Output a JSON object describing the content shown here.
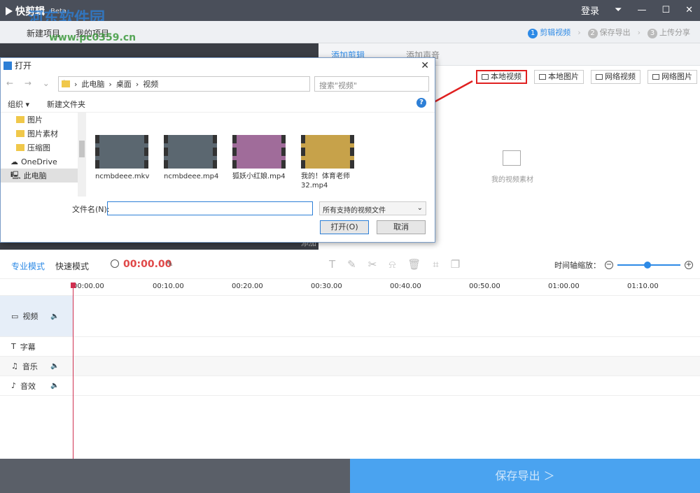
{
  "app": {
    "title": "快剪辑",
    "beta": "Beta",
    "login": "登录",
    "watermark": "河东软件园",
    "watermark_url": "www.pc0359.cn"
  },
  "toolbar2": {
    "new_project": "新建项目",
    "my_projects": "我的项目",
    "steps": [
      {
        "num": "1",
        "label": "剪辑视频"
      },
      {
        "num": "2",
        "label": "保存导出"
      },
      {
        "num": "3",
        "label": "上传分享"
      }
    ]
  },
  "material": {
    "tabs": [
      "添加剪辑",
      "添加声音"
    ],
    "buttons": [
      "本地视频",
      "本地图片",
      "网络视频",
      "网络图片"
    ],
    "empty_text": "我的视频素材",
    "preview_label": "添加剪辑素材"
  },
  "dialog": {
    "title": "打开",
    "path": [
      "此电脑",
      "桌面",
      "视频"
    ],
    "search_placeholder": "搜索\"视频\"",
    "organize": "组织 ▾",
    "new_folder": "新建文件夹",
    "nav_items": [
      "图片",
      "图片素材",
      "压缩图",
      "OneDrive",
      "此电脑"
    ],
    "files": [
      "ncmbdeee.mkv",
      "ncmbdeee.mp4",
      "狐妖小红娘.mp4",
      "我的！体育老师32.mp4"
    ],
    "filename_label": "文件名(N):",
    "filetype": "所有支持的视频文件",
    "open_btn": "打开(O)",
    "cancel_btn": "取消"
  },
  "editor": {
    "mode_pro": "专业模式",
    "mode_fast": "快速模式",
    "timecode": "00:00.00",
    "zoom_label": "时间轴缩放：",
    "ruler": [
      "00:00.00",
      "00:10.00",
      "00:20.00",
      "00:30.00",
      "00:40.00",
      "00:50.00",
      "01:00.00",
      "01:10.00"
    ],
    "tracks": [
      "视频",
      "字幕",
      "音乐",
      "音效"
    ]
  },
  "export_label": "保存导出 ＞",
  "colors": {
    "accent": "#2d8ae6",
    "timecode": "#e04848",
    "highlight_box": "#e02020"
  }
}
